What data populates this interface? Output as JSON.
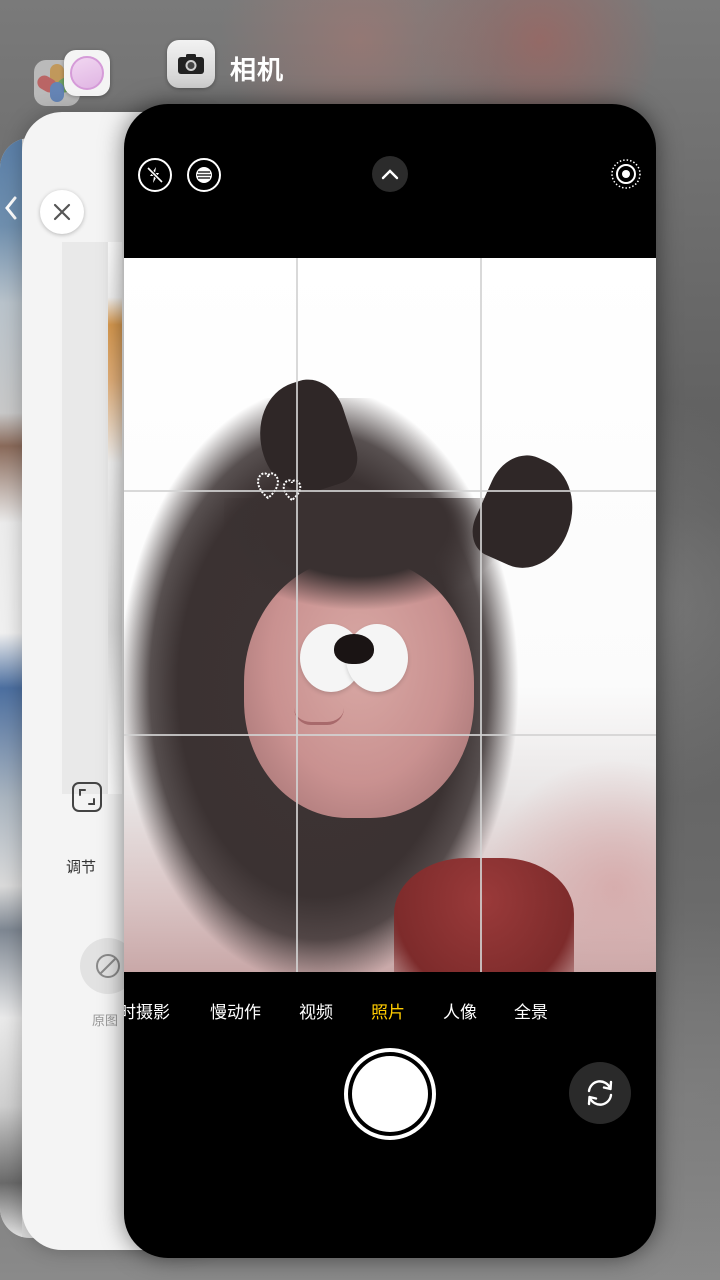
{
  "switcher": {
    "camera_app_title": "相机"
  },
  "edit_panel": {
    "adjust_label": "调节",
    "original_label": "原图"
  },
  "camera": {
    "modes": [
      {
        "label": "延时摄影",
        "active": false
      },
      {
        "label": "慢动作",
        "active": false
      },
      {
        "label": "视频",
        "active": false
      },
      {
        "label": "照片",
        "active": true
      },
      {
        "label": "人像",
        "active": false
      },
      {
        "label": "全景",
        "active": false
      }
    ],
    "colors": {
      "active_mode": "#ffcc00",
      "background": "#000000"
    },
    "icons": {
      "flash": "flash-off-icon",
      "live": "live-photo-icon",
      "expand": "chevron-up-icon",
      "live_target": "live-target-icon",
      "flip": "camera-flip-icon"
    }
  }
}
